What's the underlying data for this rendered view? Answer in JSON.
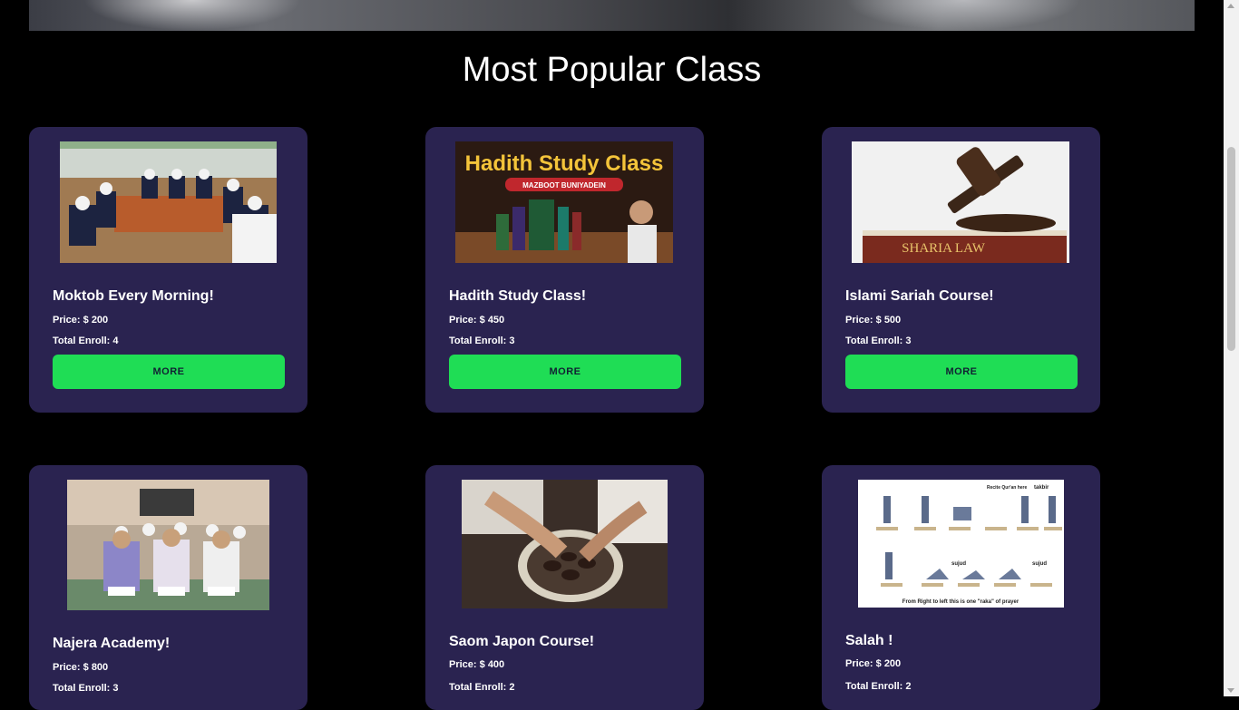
{
  "section_title": "Most Popular Class",
  "more_label": "MORE",
  "price_prefix": "Price: $ ",
  "enroll_prefix": "Total Enroll: ",
  "colors": {
    "card_bg": "#2a2350",
    "button_bg": "#1fdd55",
    "page_bg": "#000000"
  },
  "classes": [
    {
      "title": "Moktob Every Morning!",
      "price": "200",
      "enroll": "4",
      "image": "students-reading-quran-photo"
    },
    {
      "title": "Hadith Study Class!",
      "price": "450",
      "enroll": "3",
      "image": "hadith-study-class-banner",
      "image_text": {
        "headline": "Hadith Study Class",
        "ribbon": "MAZBOOT BUNIYADEIN"
      }
    },
    {
      "title": "Islami Sariah Course!",
      "price": "500",
      "enroll": "3",
      "image": "gavel-on-book-photo",
      "image_text": {
        "book": "SHARIA LAW"
      }
    },
    {
      "title": "Najera Academy!",
      "price": "800",
      "enroll": "3",
      "image": "classroom-quran-students-photo"
    },
    {
      "title": "Saom Japon Course!",
      "price": "400",
      "enroll": "2",
      "image": "hands-with-dates-bowl-photo"
    },
    {
      "title": "Salah !",
      "price": "200",
      "enroll": "2",
      "image": "prayer-positions-diagram",
      "image_text": {
        "recite": "Recite Qur'an here",
        "takbir": "takbir",
        "sujud_1": "sujud",
        "sujud_2": "sujud",
        "caption": "From Right to left this is one \"raka\" of prayer"
      }
    }
  ]
}
